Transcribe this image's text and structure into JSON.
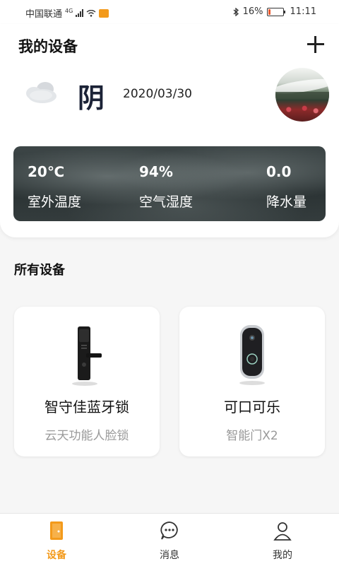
{
  "status_bar": {
    "carrier": "中国联通",
    "network": "4G",
    "battery_percent": "16%",
    "battery_level": 0.16,
    "time": "11:11"
  },
  "header": {
    "title": "我的设备",
    "add_icon": "plus-icon"
  },
  "weather": {
    "icon": "cloud-icon",
    "condition": "阴",
    "date": "2020/03/30"
  },
  "stats": [
    {
      "value": "20℃",
      "label": "室外温度"
    },
    {
      "value": "94%",
      "label": "空气湿度"
    },
    {
      "value": "0.0",
      "label": "降水量"
    }
  ],
  "section": {
    "title": "所有设备"
  },
  "devices": [
    {
      "name": "智守佳蓝牙锁",
      "model": "云天功能人脸锁",
      "icon": "door-lock-icon"
    },
    {
      "name": "可口可乐",
      "model": "智能门X2",
      "icon": "smart-doorbell-icon"
    }
  ],
  "bottom_nav": [
    {
      "label": "设备",
      "icon": "door-icon",
      "active": true
    },
    {
      "label": "消息",
      "icon": "chat-icon",
      "active": false
    },
    {
      "label": "我的",
      "icon": "person-icon",
      "active": false
    }
  ],
  "colors": {
    "accent": "#f39a1b",
    "title_text": "#111111",
    "muted_text": "#999999"
  }
}
